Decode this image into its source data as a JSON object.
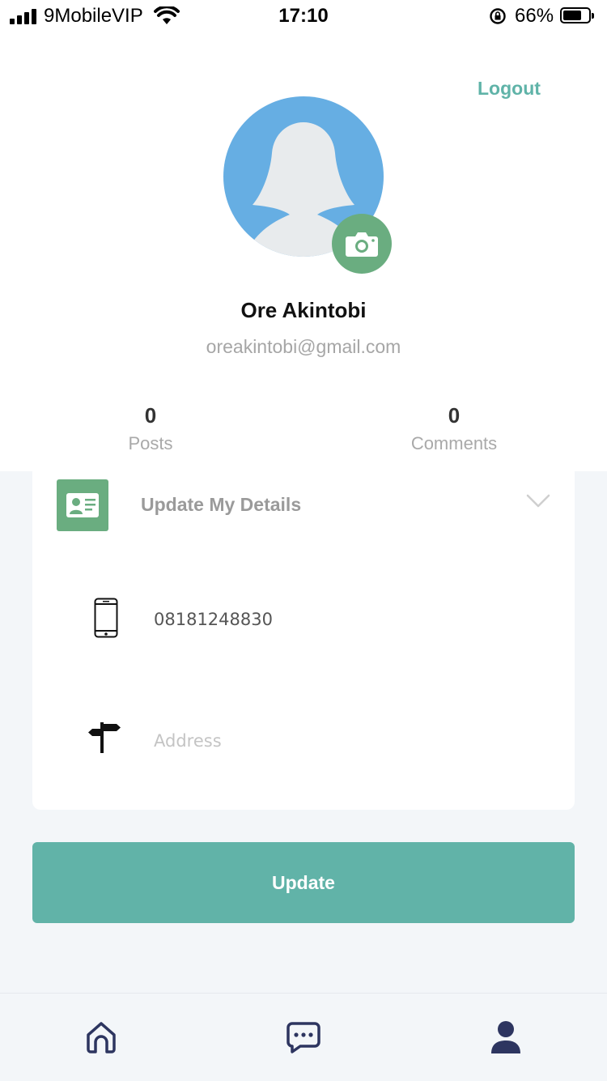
{
  "status_bar": {
    "carrier": "9MobileVIP",
    "time": "17:10",
    "battery_percent": "66%"
  },
  "header": {
    "logout_label": "Logout"
  },
  "profile": {
    "name": "Ore Akintobi",
    "email": "oreakintobi@gmail.com",
    "stats": [
      {
        "count": "0",
        "label": "Posts"
      },
      {
        "count": "0",
        "label": "Comments"
      }
    ]
  },
  "details": {
    "title": "Update My Details",
    "phone_value": "08181248830",
    "address_placeholder": "Address"
  },
  "actions": {
    "update_label": "Update"
  },
  "theme": {
    "accent": "#61b3a8",
    "green": "#6aad80",
    "avatar_bg": "#66aee3",
    "nav_icon": "#2d3560"
  },
  "bottom_nav": {
    "items": [
      "home-icon",
      "chat-icon",
      "user-icon"
    ],
    "active": "user-icon"
  }
}
